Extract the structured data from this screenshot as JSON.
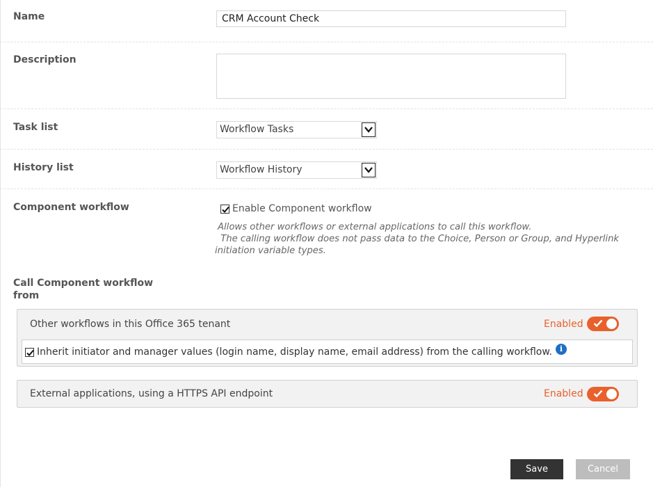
{
  "form": {
    "name": {
      "label": "Name",
      "value": "CRM Account Check"
    },
    "description": {
      "label": "Description",
      "value": ""
    },
    "task_list": {
      "label": "Task list",
      "selected": "Workflow Tasks"
    },
    "history_list": {
      "label": "History list",
      "selected": "Workflow History"
    },
    "component_workflow": {
      "label": "Component workflow",
      "checkbox_label": "Enable Component workflow",
      "checked": true,
      "help_line1": "Allows other workflows or external applications to call this workflow.",
      "help_line2": " The calling workflow does not pass data to the Choice, Person or Group, and Hyperlink",
      "help_line3": "initiation variable types."
    },
    "call_from": {
      "label_line1": "Call Component workflow",
      "label_line2": "from",
      "panels": [
        {
          "title": "Other workflows in this Office 365 tenant",
          "status": "Enabled",
          "toggle_on": true,
          "inherit_checkbox_label": "Inherit initiator and manager values (login name, display name, email address) from the calling workflow.",
          "inherit_checked": true,
          "info_icon": "info-icon"
        },
        {
          "title": "External applications, using a HTTPS API endpoint",
          "status": "Enabled",
          "toggle_on": true
        }
      ]
    }
  },
  "actions": {
    "save_label": "Save",
    "cancel_label": "Cancel"
  },
  "colors": {
    "accent": "#e8602c",
    "info": "#1f6fc6",
    "save_bg": "#333333",
    "cancel_bg": "#bdbdbd"
  }
}
